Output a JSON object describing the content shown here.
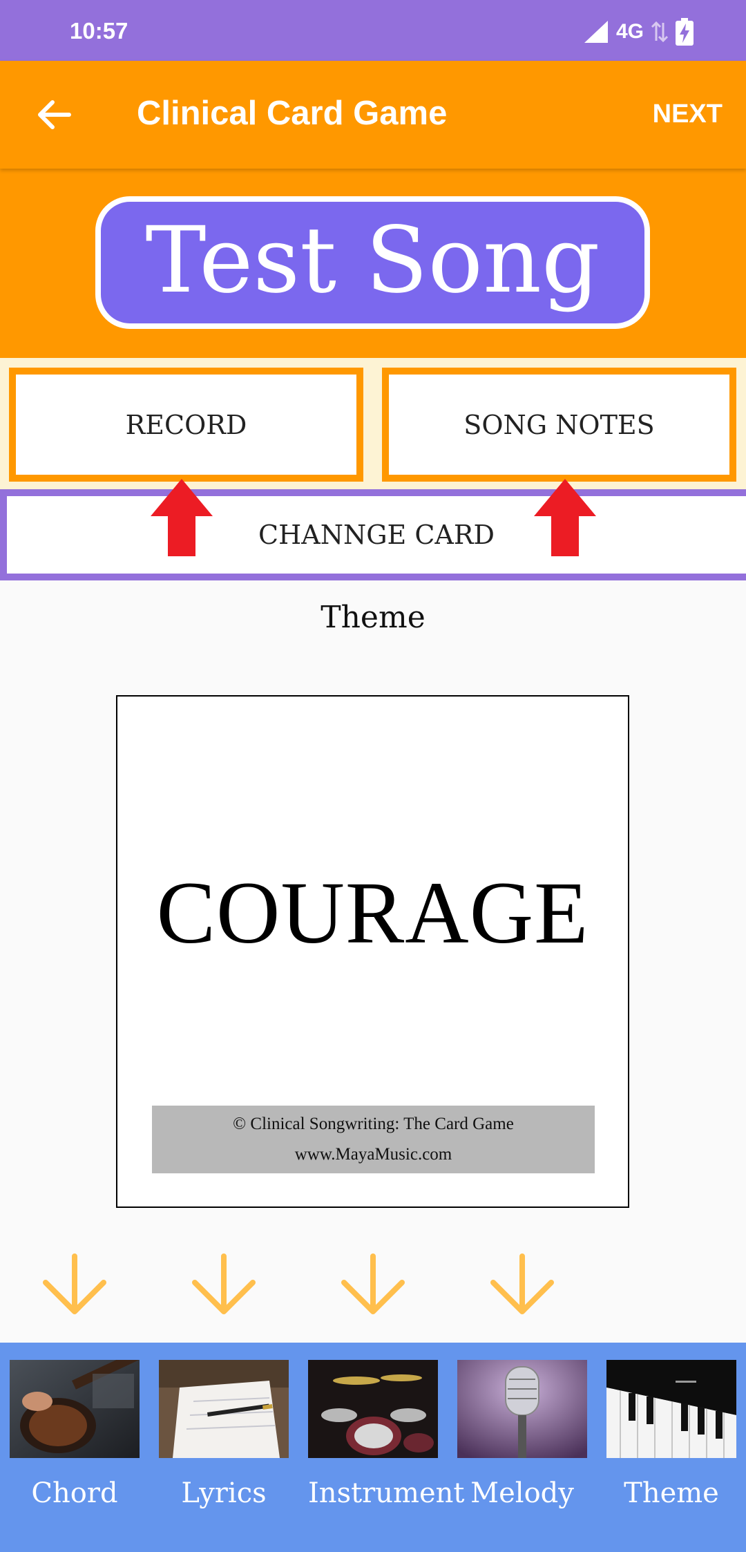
{
  "status": {
    "time": "10:57",
    "network": "4G"
  },
  "app_bar": {
    "title": "Clinical Card Game",
    "next_label": "NEXT"
  },
  "song": {
    "title": "Test Song"
  },
  "actions": {
    "record_label": "RECORD",
    "song_notes_label": "SONG NOTES",
    "change_card_label": "CHANNGE CARD"
  },
  "card": {
    "category": "Theme",
    "word": "COURAGE",
    "footer_line1": "© Clinical Songwriting: The Card Game",
    "footer_line2": "www.MayaMusic.com"
  },
  "categories": [
    {
      "label": "Chord",
      "icon": "guitar-photo"
    },
    {
      "label": "Lyrics",
      "icon": "notebook-pen-photo"
    },
    {
      "label": "Instrument",
      "icon": "drum-kit-photo"
    },
    {
      "label": "Melody",
      "icon": "microphone-photo"
    },
    {
      "label": "Theme",
      "icon": "piano-photo"
    }
  ],
  "colors": {
    "status_bar": "#9370db",
    "app_bar": "#ff9800",
    "title_pill": "#7b68ee",
    "change_card_border": "#9370db",
    "red_arrow": "#ec1c24",
    "down_arrow": "#ffbf4d",
    "bottom_bar": "#6495ed"
  }
}
